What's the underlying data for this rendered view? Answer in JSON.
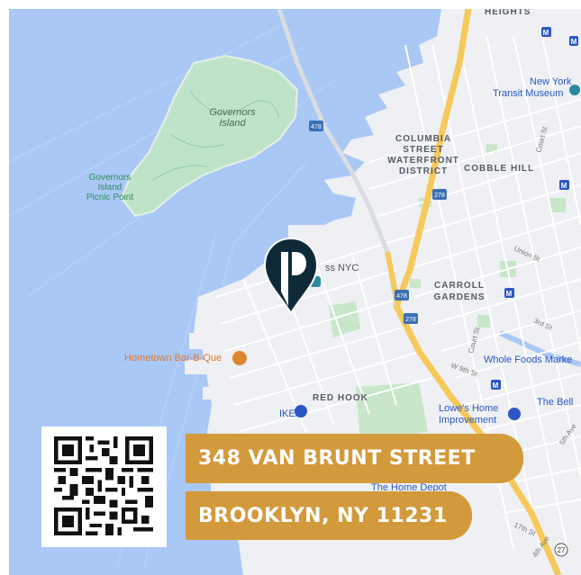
{
  "map": {
    "colors": {
      "water": "#a9c8f6",
      "land": "#eef0f3",
      "park": "#bfe3c9",
      "highway": "#f6c95a",
      "road": "#ffffff",
      "pin": "#0e2a38",
      "accent": "#d39a3c"
    },
    "labels": {
      "heights": "HEIGHTS",
      "governors_island": "Governors\nIsland",
      "governors_picnic": "Governors\nIsland\nPicnic Point",
      "columbia_street": "COLUMBIA\nSTREET\nWATERFRONT\nDISTRICT",
      "cobble_hill": "COBBLE HILL",
      "carroll_gardens": "CARROLL\nGARDENS",
      "red_hook": "RED HOOK",
      "ny_transit_museum": "New York\nTransit Museum",
      "ikea": "IKEA",
      "hometown_bbq": "Hometown Bar-B-Que",
      "whole_foods": "Whole Foods Marke",
      "the_bell": "The Bell",
      "lowes": "Lowe's Home\nImprovement",
      "home_depot": "The Home Depot",
      "nyc_poi": "ss NYC",
      "union_st": "Union St",
      "third_st": "3rd St",
      "ninth_st": "W 9th St",
      "court_st_n": "Court St",
      "court_st_s": "Court St",
      "seventeenth_st": "17th St",
      "fourth_ave": "4th Ave",
      "fifth_ave": "5th Ave",
      "shield_478_a": "478",
      "shield_478_b": "478",
      "shield_278_a": "278",
      "shield_278_b": "278",
      "shield_27": "27",
      "metro": "M"
    },
    "icons": [
      "location-pin-icon",
      "museum-icon",
      "restaurant-icon",
      "store-icon",
      "metro-icon",
      "highway-shield-icon"
    ]
  },
  "qr": {
    "icon": "qr-code-icon"
  },
  "address": {
    "line1": "348 VAN BRUNT STREET",
    "line2": "BROOKLYN, NY 11231"
  }
}
